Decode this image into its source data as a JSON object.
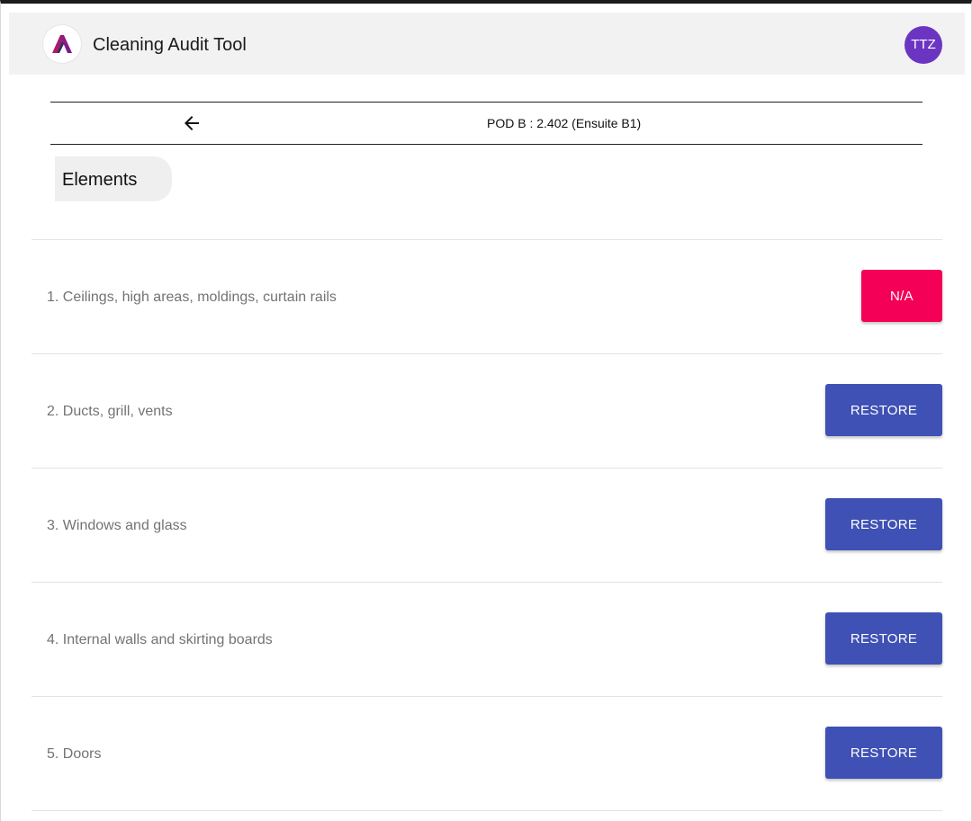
{
  "app": {
    "title": "Cleaning Audit Tool",
    "user_initials": "TTZ"
  },
  "header": {
    "location_title": "POD B : 2.402 (Ensuite B1)"
  },
  "section": {
    "label": "Elements"
  },
  "elements": [
    {
      "label": "1. Ceilings, high areas, moldings, curtain rails",
      "action": "N/A",
      "action_type": "na"
    },
    {
      "label": "2. Ducts, grill, vents",
      "action": "RESTORE",
      "action_type": "restore"
    },
    {
      "label": "3. Windows and glass",
      "action": "RESTORE",
      "action_type": "restore"
    },
    {
      "label": "4. Internal walls and skirting boards",
      "action": "RESTORE",
      "action_type": "restore"
    },
    {
      "label": "5. Doors",
      "action": "RESTORE",
      "action_type": "restore"
    }
  ],
  "icons": {
    "back": "arrow-left-icon",
    "logo": "app-logo-icon"
  },
  "colors": {
    "na_button": "#f50057",
    "restore_button": "#3f51b5",
    "avatar": "#6b35c2",
    "app_bar": "#f2f2f2"
  }
}
